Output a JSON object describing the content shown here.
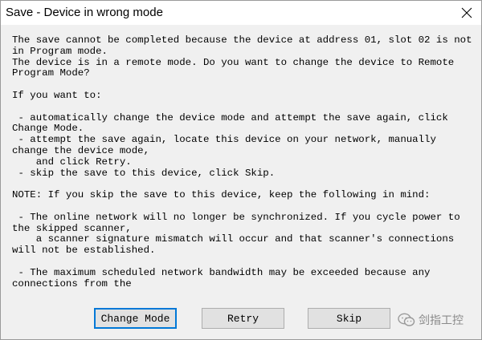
{
  "window": {
    "title": "Save - Device in wrong mode",
    "close_icon": "close-icon"
  },
  "message": {
    "paragraphs": [
      "The save cannot be completed because the device at address 01, slot 02 is not in Program mode.\nThe device is in a remote mode. Do you want to change the device to Remote Program Mode?",
      "If you want to:",
      " - automatically change the device mode and attempt the save again, click Change Mode.\n - attempt the save again, locate this device on your network, manually change the device mode,\n    and click Retry.\n - skip the save to this device, click Skip.",
      "NOTE: If you skip the save to this device, keep the following in mind:",
      " - The online network will no longer be synchronized. If you cycle power to the skipped scanner,\n    a scanner signature mismatch will occur and that scanner's connections will not be established.",
      " - The maximum scheduled network bandwidth may be exceeded because any connections from the"
    ]
  },
  "buttons": {
    "change_mode": "Change Mode",
    "retry": "Retry",
    "skip": "Skip"
  },
  "watermark": {
    "text": "剑指工控",
    "icon": "wechat-icon"
  }
}
